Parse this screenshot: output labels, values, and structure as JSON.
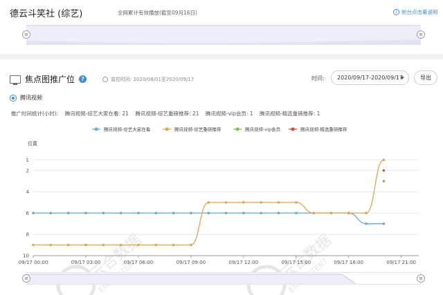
{
  "header": {
    "title": "德云斗笑社 (综艺)",
    "subtitle": "全网累计有效播放(截至09月16日)",
    "link": "前台点击量说明"
  },
  "section": {
    "title": "焦点图推广位",
    "period": "监控时间: 2020/08/01至2020/09/17",
    "time_label": "时间:",
    "time_value": "2020/09/17-2020/09/17",
    "export": "导出",
    "platform": "腾讯视频",
    "stats_label": "推广时间统计(小时):",
    "stats": [
      "腾讯视频-综艺大家在看: 21",
      "腾讯视频-综艺重磅推荐: 21",
      "腾讯视频-vip会员: 1",
      "腾讯视频-精选重磅推荐: 1"
    ]
  },
  "watermark": {
    "cn": "云合数据",
    "en": "ENLIGHTENT"
  },
  "colors": {
    "blue": "#5aade6",
    "orange": "#e8a247",
    "green": "#7cc440",
    "red": "#d94a3c",
    "accent": "#3c8de0"
  },
  "chart_data": {
    "type": "line",
    "ylabel": "位置",
    "yticks": [
      "1",
      "2",
      "4",
      "6",
      "8",
      "10"
    ],
    "ylim": [
      10,
      0
    ],
    "xticks": [
      "09/17 00:00",
      "09/17 03:00",
      "09/17 06:00",
      "09/17 09:00",
      "09/17 12:00",
      "09/17 15:00",
      "09/17 18:00",
      "09/17 21:00"
    ],
    "xlim_hours": [
      0,
      22
    ],
    "series": [
      {
        "name": "腾讯视频-综艺大家在看",
        "color": "#5aade6",
        "x": [
          0,
          1,
          2,
          3,
          4,
          5,
          6,
          7,
          8,
          9,
          10,
          11,
          12,
          13,
          14,
          15,
          16,
          17,
          18,
          19,
          20
        ],
        "y": [
          6,
          6,
          6,
          6,
          6,
          6,
          6,
          6,
          6,
          6,
          6,
          6,
          6,
          6,
          6,
          6,
          6,
          6,
          6,
          7,
          7
        ]
      },
      {
        "name": "腾讯视频-综艺重磅推荐",
        "color": "#e8a247",
        "x": [
          0,
          1,
          2,
          3,
          4,
          5,
          6,
          7,
          8,
          9,
          10,
          11,
          12,
          13,
          14,
          15,
          16,
          17,
          18,
          19,
          20
        ],
        "y": [
          9,
          9,
          9,
          9,
          9,
          9,
          9,
          9,
          9,
          9,
          5,
          5,
          5,
          5,
          5,
          5,
          6,
          6,
          6,
          6,
          1
        ]
      },
      {
        "name": "腾讯视频-vip会员",
        "color": "#7cc440",
        "x": [
          20
        ],
        "y": [
          3
        ]
      },
      {
        "name": "腾讯视频-精选重磅推荐",
        "color": "#d94a3c",
        "x": [
          20
        ],
        "y": [
          2
        ]
      }
    ]
  }
}
